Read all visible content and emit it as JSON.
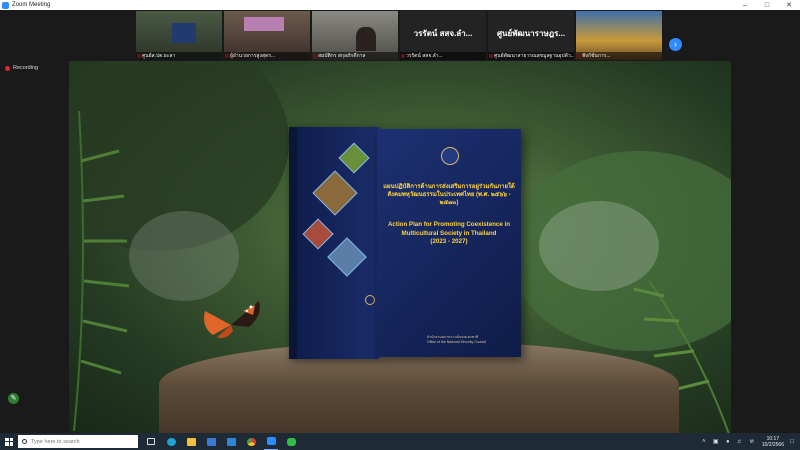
{
  "window": {
    "title": "Zoom Meeting"
  },
  "participants": [
    {
      "name": "ศูนย์ส.ปต.ยะลา"
    },
    {
      "name": "ผู้อำนวยการสูงสุดร..."
    },
    {
      "name": "สมบัติกร สกุลภักดีกาล"
    },
    {
      "name": "วรรัตน์ สสจ.ลำ...",
      "display": "วรรัตน์  สสจ.ลำ..."
    },
    {
      "name": "ศูนย์พัฒนาสาธารณสุขมูลฐานอุปตัว...",
      "display": "ศูนย์พัฒนาราษฎร..."
    },
    {
      "name": "ฟังก์ชั่นการ..."
    }
  ],
  "recording": {
    "label": "Recording"
  },
  "book": {
    "thai_title": "แผนปฏิบัติการด้านการส่งเสริมการอยู่ร่วมกันภายใต้สังคมพหุวัฒนธรรมในประเทศไทย (พ.ศ. ๒๕๖๖ - ๒๕๗๐)",
    "en_title": "Action Plan for Promoting Coexistence in Multicultural Society in Thailand",
    "years": "(2023 - 2027)",
    "publisher_th": "สำนักงานสภาความมั่นคงแห่งชาติ",
    "publisher_en": "Office of the National Security Council"
  },
  "taskbar": {
    "search_placeholder": "Type here to search",
    "time": "10:17",
    "date": "10/2/2566"
  },
  "colors": {
    "zoom_blue": "#2d8cff",
    "recording_red": "#e02828",
    "book_title_yellow": "#ffd23a",
    "book_navy": "#14245a"
  }
}
